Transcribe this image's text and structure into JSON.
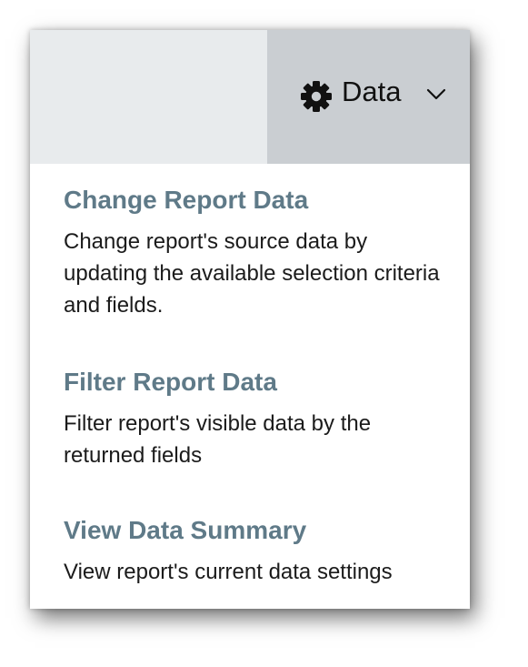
{
  "toolbar": {
    "button_label": "Data",
    "button_icon": "gear-icon",
    "dropdown_icon": "chevron-down-icon"
  },
  "menu": {
    "items": [
      {
        "title": "Change Report Data",
        "description": "Change report's source data by updating the available selection criteria and fields."
      },
      {
        "title": "Filter Report Data",
        "description": "Filter report's visible data by the returned fields"
      },
      {
        "title": "View Data Summary",
        "description": "View report's current data settings"
      }
    ]
  },
  "colors": {
    "topbar": "#e8ebed",
    "button_bg": "#caced2",
    "title": "#5f7a88",
    "text": "#1b1b1b"
  }
}
